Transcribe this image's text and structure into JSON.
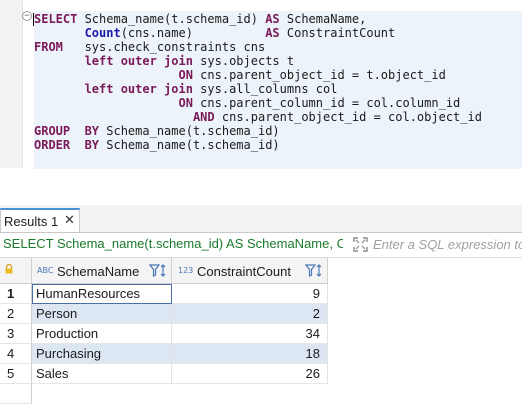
{
  "editor": {
    "collapse_glyph": "−",
    "lines": [
      [
        {
          "t": "SELECT",
          "c": "kw"
        },
        {
          "t": " Schema_name(t.schema_id) "
        },
        {
          "t": "AS",
          "c": "kw"
        },
        {
          "t": " SchemaName,"
        }
      ],
      [
        {
          "t": "       "
        },
        {
          "t": "Count",
          "c": "fn"
        },
        {
          "t": "(cns.name)          "
        },
        {
          "t": "AS",
          "c": "kw"
        },
        {
          "t": " ConstraintCount"
        }
      ],
      [
        {
          "t": "FROM",
          "c": "kw"
        },
        {
          "t": "   sys.check_constraints cns"
        }
      ],
      [
        {
          "t": "       "
        },
        {
          "t": "left outer join",
          "c": "kw"
        },
        {
          "t": " sys.objects t"
        }
      ],
      [
        {
          "t": "                    "
        },
        {
          "t": "ON",
          "c": "kw"
        },
        {
          "t": " cns.parent_object_id = t.object_id"
        }
      ],
      [
        {
          "t": "       "
        },
        {
          "t": "left outer join",
          "c": "kw"
        },
        {
          "t": " sys.all_columns col"
        }
      ],
      [
        {
          "t": "                    "
        },
        {
          "t": "ON",
          "c": "kw"
        },
        {
          "t": " cns.parent_column_id = col.column_id"
        }
      ],
      [
        {
          "t": "                      "
        },
        {
          "t": "AND",
          "c": "kw"
        },
        {
          "t": " cns.parent_object_id = col.object_id"
        }
      ],
      [
        {
          "t": "GROUP",
          "c": "kw"
        },
        {
          "t": "  "
        },
        {
          "t": "BY",
          "c": "kw"
        },
        {
          "t": " Schema_name(t.schema_id)"
        }
      ],
      [
        {
          "t": "ORDER",
          "c": "kw"
        },
        {
          "t": "  "
        },
        {
          "t": "BY",
          "c": "kw"
        },
        {
          "t": " Schema_name(t.schema_id)"
        }
      ]
    ]
  },
  "results_tab": {
    "label": "Results 1",
    "close_glyph": "✕"
  },
  "query_bar": {
    "text": "SELECT Schema_name(t.schema_id) AS SchemaName, Count(cns.name) AS ConstraintCount FROM sys.check_constraints cns",
    "filter_placeholder": "Enter a SQL expression to filter results (use Ctrl+Space)"
  },
  "grid": {
    "columns": [
      {
        "type_badge": "ABC",
        "label": "SchemaName"
      },
      {
        "type_badge": "123",
        "label": "ConstraintCount"
      }
    ],
    "rows": [
      {
        "num": "1",
        "name": "HumanResources",
        "count": "9"
      },
      {
        "num": "2",
        "name": "Person",
        "count": "2"
      },
      {
        "num": "3",
        "name": "Production",
        "count": "34"
      },
      {
        "num": "4",
        "name": "Purchasing",
        "count": "18"
      },
      {
        "num": "5",
        "name": "Sales",
        "count": "26"
      }
    ]
  },
  "colors": {
    "keyword": "#7a1a58",
    "function": "#1a1aa6",
    "query_text": "#1a7a2a",
    "alt_row": "#dde7f3",
    "editor_highlight": "#edf3fa"
  }
}
